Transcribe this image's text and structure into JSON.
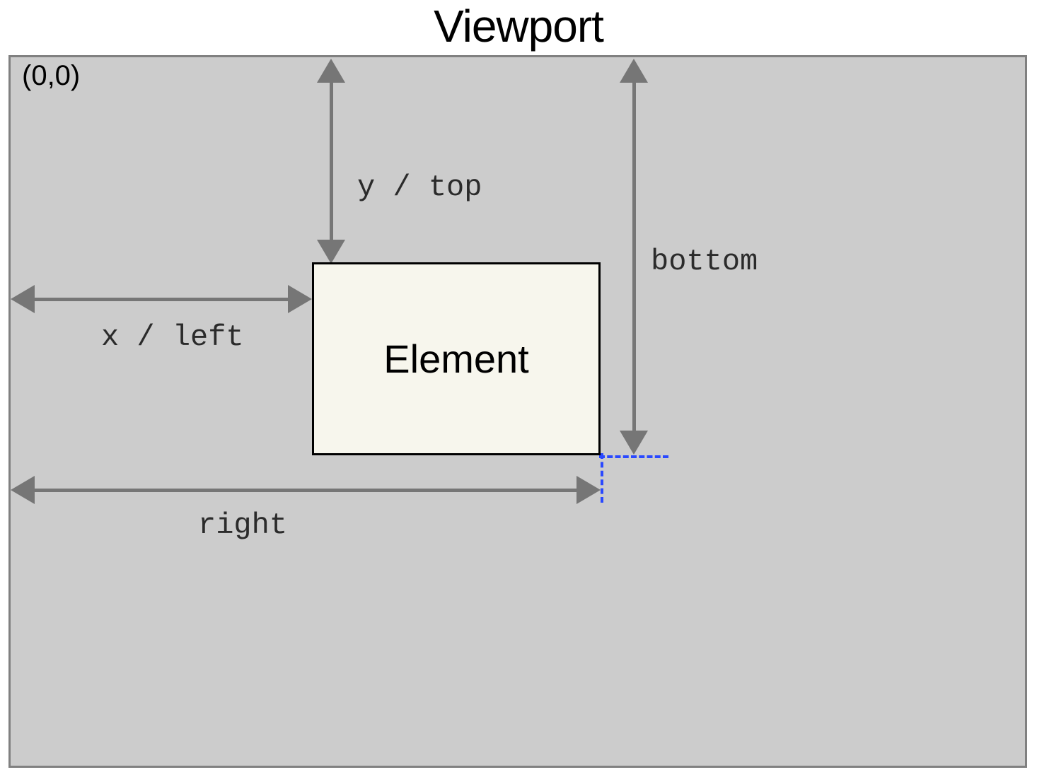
{
  "title": "Viewport",
  "origin_label": "(0,0)",
  "element_label": "Element",
  "measures": {
    "y_top": "y / top",
    "x_left": "x / left",
    "bottom": "bottom",
    "right": "right"
  },
  "colors": {
    "viewport_bg": "#cccccc",
    "viewport_border": "#808080",
    "element_bg": "#f7f6ed",
    "arrow": "#767676",
    "dashed_guide": "#2a49ff"
  }
}
